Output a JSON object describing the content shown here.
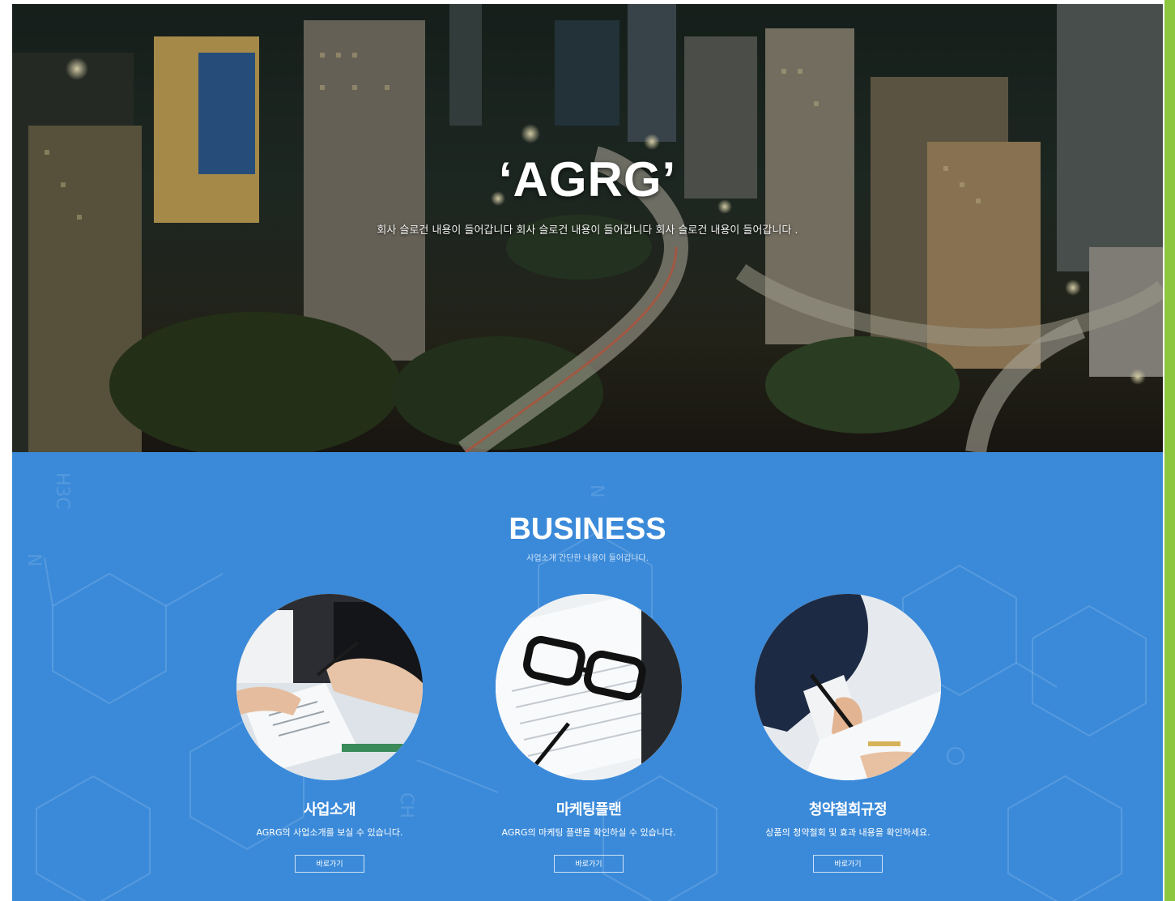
{
  "hero": {
    "title": "‘AGRG’",
    "slogan": "회사 슬로건 내용이 들어갑니다 회사 슬로건 내용이 들어갑니다 회사 슬로건 내용이 들어갑니다 ."
  },
  "business": {
    "title": "BUSINESS",
    "subtitle": "사업소개 간단한 내용이 들어갑니다.",
    "cards": [
      {
        "title": "사업소개",
        "desc": "AGRG의 사업소개를 보실 수 있습니다.",
        "button": "바로가기",
        "icon": "meeting-photo"
      },
      {
        "title": "마케팅플랜",
        "desc": "AGRG의 마케팅 플랜을 확인하실 수 있습니다.",
        "button": "바로가기",
        "icon": "glasses-document-photo"
      },
      {
        "title": "청약철회규정",
        "desc": "상품의 청약철회 및 효과 내용을 확인하세요.",
        "button": "바로가기",
        "icon": "signing-photo"
      }
    ]
  },
  "colors": {
    "business_bg": "#3b8ad9",
    "side_bar": "#8dc63f",
    "text": "#ffffff"
  }
}
